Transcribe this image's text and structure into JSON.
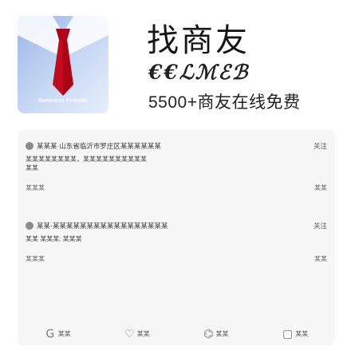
{
  "app": {
    "title": "找商友",
    "subtitle": "€€ℒℳℰℬ",
    "tagline": "5500+商友在线免费",
    "logo_caption": "Business Friends"
  },
  "posts": [
    {
      "user": "某某某·山东省临沂市罗庄区某某某某某某",
      "action": "关注",
      "body_line1": "某某某某某某某某，某某某某某某某某某某",
      "body_line2": "某某",
      "time": "某某某",
      "meta": "某某"
    },
    {
      "user": "某某·某某某某某某某某某某某某某某某某某",
      "action": "关注",
      "body_line1": "某某 某某某: 某某某",
      "body_line2": "",
      "time": "某某某",
      "meta": "某某"
    }
  ],
  "tabbar": [
    {
      "icon": "Ｇ",
      "label": "某某"
    },
    {
      "icon": "♡",
      "label": "某某"
    },
    {
      "icon": "⌬",
      "label": "某某"
    },
    {
      "icon": "▢",
      "label": "某某"
    }
  ]
}
